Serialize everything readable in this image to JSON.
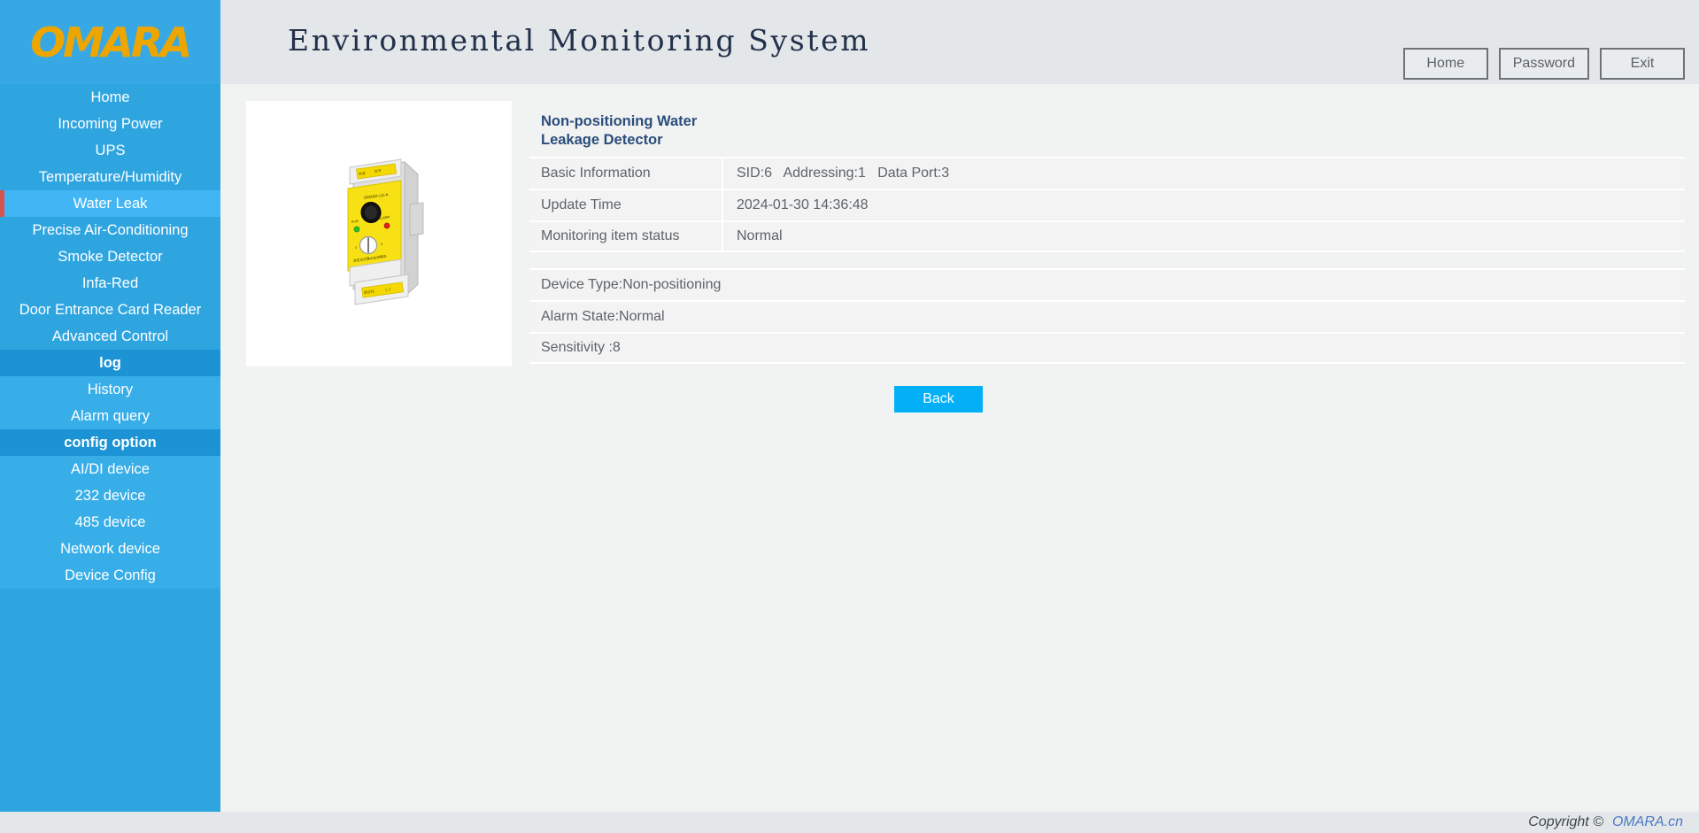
{
  "header": {
    "logo": "OMARA",
    "title": "Environmental Monitoring System",
    "buttons": [
      {
        "label": "Home",
        "name": "home-button"
      },
      {
        "label": "Password",
        "name": "password-button"
      },
      {
        "label": "Exit",
        "name": "exit-button"
      }
    ]
  },
  "sidebar": {
    "main_items": [
      {
        "label": "Home",
        "active": false
      },
      {
        "label": "Incoming Power",
        "active": false
      },
      {
        "label": "UPS",
        "active": false
      },
      {
        "label": "Temperature/Humidity",
        "active": false
      },
      {
        "label": "Water Leak",
        "active": true
      },
      {
        "label": "Precise Air-Conditioning",
        "active": false
      },
      {
        "label": "Smoke Detector",
        "active": false
      },
      {
        "label": "Infa-Red",
        "active": false
      },
      {
        "label": "Door Entrance Card Reader",
        "active": false
      },
      {
        "label": "Advanced Control",
        "active": false
      }
    ],
    "log_section": "log",
    "log_items": [
      {
        "label": "History"
      },
      {
        "label": "Alarm query"
      }
    ],
    "config_section": "config option",
    "config_items": [
      {
        "label": "AI/DI device"
      },
      {
        "label": "232 device"
      },
      {
        "label": "485 device"
      },
      {
        "label": "Network device"
      },
      {
        "label": "Device Config"
      }
    ]
  },
  "main": {
    "device_title": "Non-positioning Water Leakage Detector",
    "device_image_alt": "water-leak-detector-module",
    "info_rows": [
      {
        "label": "Basic Information",
        "value": "SID:6   Addressing:1   Data Port:3"
      },
      {
        "label": "Update Time",
        "value": "2024-01-30 14:36:48"
      },
      {
        "label": "Monitoring item status",
        "value": "Normal"
      }
    ],
    "detail_rows": [
      {
        "value": "Device Type:Non-positioning"
      },
      {
        "value": "Alarm State:Normal"
      },
      {
        "value": "Sensitivity :8"
      }
    ],
    "back_label": "Back"
  },
  "footer": {
    "copyright": "Copyright ©",
    "site": "OMARA.cn"
  },
  "colors": {
    "sidebar_blue": "#2fa5e0",
    "sidebar_active": "#42b6f5",
    "sidebar_section": "#1b93d4",
    "active_marker_red": "#d9534f",
    "logo_orange": "#eda600",
    "header_band": "#e3e7ea",
    "accent_cyan": "#03b0f7",
    "title_blue": "#2a4d7b",
    "link_blue": "#4a79c4"
  }
}
